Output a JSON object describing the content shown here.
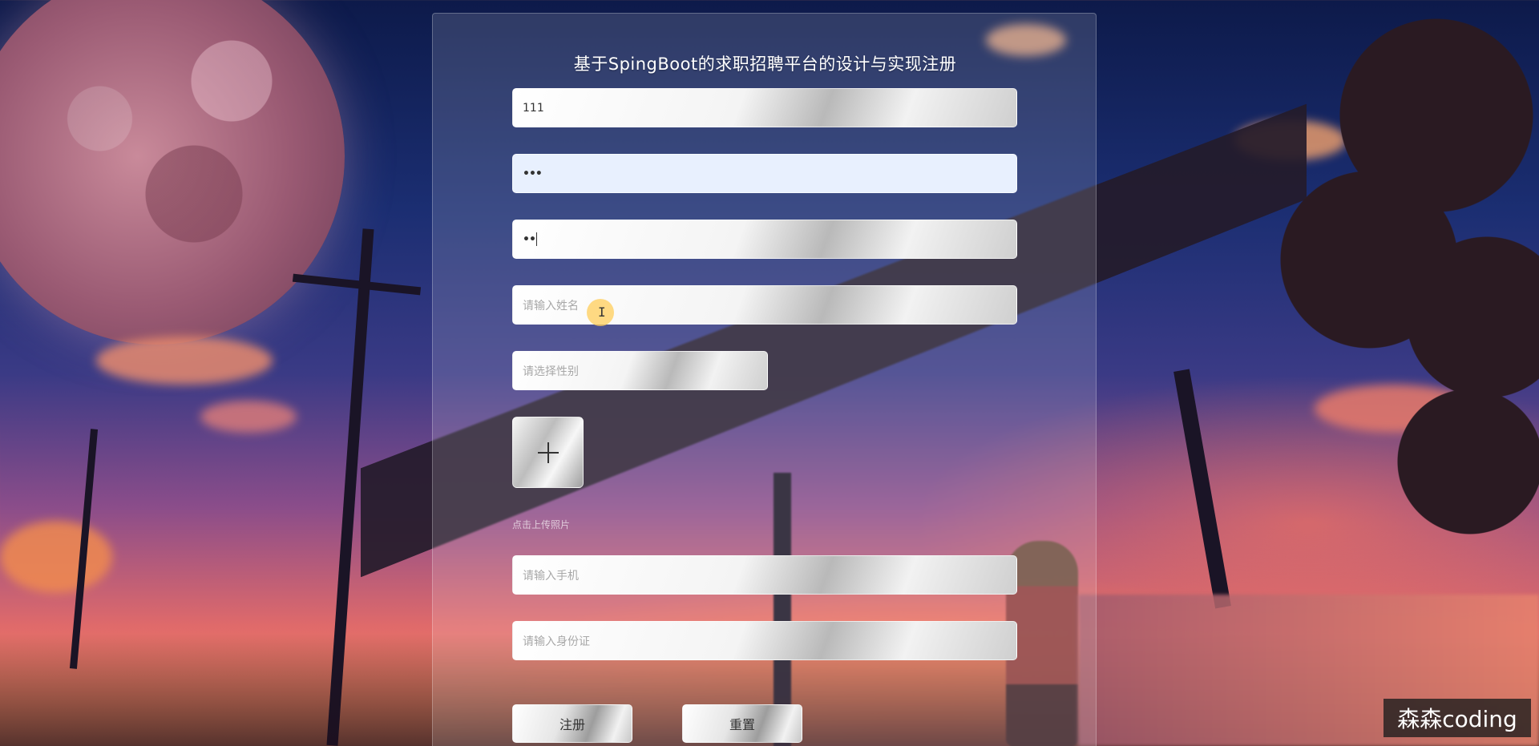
{
  "form": {
    "title": "基于SpingBoot的求职招聘平台的设计与实现注册",
    "username_value": "111",
    "password_value": "•••",
    "confirm_password_value": "••",
    "name_placeholder": "请输入姓名",
    "gender_placeholder": "请选择性别",
    "upload_icon": "plus-icon",
    "upload_hint": "点击上传照片",
    "phone_placeholder": "请输入手机",
    "idcard_placeholder": "请输入身份证",
    "register_label": "注册",
    "reset_label": "重置"
  },
  "overlay": {
    "watermark": "森森coding"
  },
  "colors": {
    "autofill_field": "#e8f0fe",
    "cursor_highlight": "#ffce5a",
    "panel_overlay": "rgba(255,255,255,0.14)"
  }
}
